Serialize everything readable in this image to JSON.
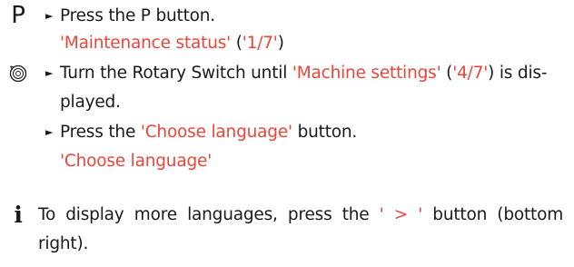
{
  "icons": {
    "p_key": "P",
    "rotary": "rotary-switch-icon",
    "info": "i"
  },
  "steps": {
    "s1": {
      "bullet": "►",
      "pre": "Press the P button."
    },
    "s1_result": {
      "q1": "'Maintenance status'",
      "mid": " (",
      "q2": "'1/7'",
      "end": ")"
    },
    "s2": {
      "bullet": "►",
      "pre": "Turn the Rotary Switch until ",
      "q1": "'Machine settings'",
      "mid": " (",
      "q2": "'4/7'",
      "post": ") is dis-",
      "cont": "played."
    },
    "s3": {
      "bullet": "►",
      "pre": "Press the ",
      "q1": "'Choose language'",
      "post": " button."
    },
    "s3_result": {
      "q1": "'Choose language'"
    }
  },
  "note": {
    "w1": "To",
    "w2": "display",
    "w3": "more",
    "w4": "languages,",
    "w5": "press",
    "w6": "the",
    "q": "' > '",
    "w7": "button",
    "w8": "(bottom",
    "line2": "right)."
  },
  "colors": {
    "accent": "#e8463a",
    "text": "#1a1a1a"
  }
}
